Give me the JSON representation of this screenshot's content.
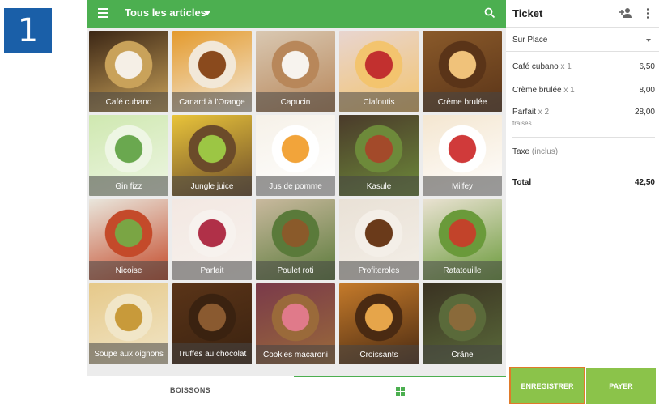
{
  "step_number": "1",
  "header": {
    "category_title": "Tous les articles"
  },
  "products": [
    {
      "label": "Café cubano",
      "colors": [
        "#3b2615",
        "#f5efe6",
        "#c9a25a"
      ]
    },
    {
      "label": "Canard à l'Orange",
      "colors": [
        "#e49a2c",
        "#8a4a1d",
        "#f2e8d8"
      ]
    },
    {
      "label": "Capucin",
      "colors": [
        "#d9c8b2",
        "#f7f3ee",
        "#b8875a"
      ]
    },
    {
      "label": "Clafoutis",
      "colors": [
        "#e8d5d0",
        "#c2302f",
        "#f3c46e"
      ]
    },
    {
      "label": "Crème brulée",
      "colors": [
        "#8a5a2a",
        "#f0c27a",
        "#5a3418"
      ]
    },
    {
      "label": "Gin fizz",
      "colors": [
        "#cfe8b0",
        "#6aa84f",
        "#eef6e4"
      ]
    },
    {
      "label": "Jungle juice",
      "colors": [
        "#e9c43a",
        "#9cc644",
        "#6b4b2a"
      ]
    },
    {
      "label": "Jus de pomme",
      "colors": [
        "#f6f1e8",
        "#f2a43a",
        "#ffffff"
      ]
    },
    {
      "label": "Kasule",
      "colors": [
        "#4a3a2a",
        "#a34a2a",
        "#6d8a3a"
      ]
    },
    {
      "label": "Milfey",
      "colors": [
        "#f4e6d0",
        "#d03a3a",
        "#ffffff"
      ]
    },
    {
      "label": "Nicoise",
      "colors": [
        "#e9e6dc",
        "#7aa544",
        "#c44a2a"
      ]
    },
    {
      "label": "Parfait",
      "colors": [
        "#f3e8e2",
        "#b03048",
        "#f7f2ee"
      ]
    },
    {
      "label": "Poulet roti",
      "colors": [
        "#c9b99e",
        "#8a5a2a",
        "#5a7a3a"
      ]
    },
    {
      "label": "Profiteroles",
      "colors": [
        "#e9e1d6",
        "#6a3a1a",
        "#f4efe8"
      ]
    },
    {
      "label": "Ratatouille",
      "colors": [
        "#eae2d2",
        "#c2432a",
        "#6a9a3a"
      ]
    },
    {
      "label": "Soupe aux oignons",
      "colors": [
        "#e6c98a",
        "#c89a3a",
        "#f1e6c8"
      ]
    },
    {
      "label": "Truffes au chocolat",
      "colors": [
        "#5a3418",
        "#8a5a30",
        "#3a2210"
      ]
    },
    {
      "label": "Cookies macaroni",
      "colors": [
        "#7a3a4a",
        "#e07a8a",
        "#9a6a3a"
      ]
    },
    {
      "label": "Croissants",
      "colors": [
        "#c47a2a",
        "#e6a54a",
        "#4a2a12"
      ]
    },
    {
      "label": "Crâne",
      "colors": [
        "#3a3222",
        "#8a6a3a",
        "#5a6a3a"
      ]
    }
  ],
  "bottom_tabs": {
    "drinks_label": "BOISSONS"
  },
  "ticket": {
    "title": "Ticket",
    "dining_option": "Sur Place",
    "lines": [
      {
        "name": "Café cubano",
        "qty": "x 1",
        "price": "6,50",
        "note": ""
      },
      {
        "name": "Crème brulée",
        "qty": "x 1",
        "price": "8,00",
        "note": ""
      },
      {
        "name": "Parfait",
        "qty": "x 2",
        "price": "28,00",
        "note": "fraises"
      }
    ],
    "tax_label": "Taxe",
    "tax_note": "(inclus)",
    "total_label": "Total",
    "total_value": "42,50",
    "save_label": "ENREGISTRER",
    "pay_label": "PAYER"
  },
  "colors": {
    "brand_green": "#4caf50",
    "button_green": "#8bc34a",
    "highlight_orange": "#e07a2a",
    "step_badge_blue": "#1a5fa8"
  }
}
